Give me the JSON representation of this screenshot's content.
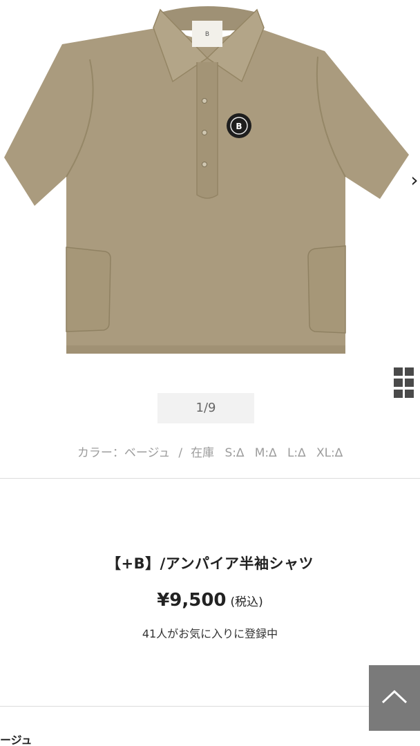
{
  "gallery": {
    "pager": "1/9",
    "next_glyph": "›"
  },
  "color_stock": {
    "color_label": "カラー：ベージュ",
    "separator": "/",
    "stock_label": "在庫",
    "sizes": [
      "S:∆",
      "M:∆",
      "L:∆",
      "XL:∆"
    ]
  },
  "product": {
    "title": "【+B】/アンパイア半袖シャツ",
    "price": "¥9,500",
    "tax_note": "(税込)",
    "favorites": "41人がお気に入りに登録中",
    "main_color": "#aa9b7e"
  },
  "footer": {
    "partial_label": "ージュ"
  }
}
